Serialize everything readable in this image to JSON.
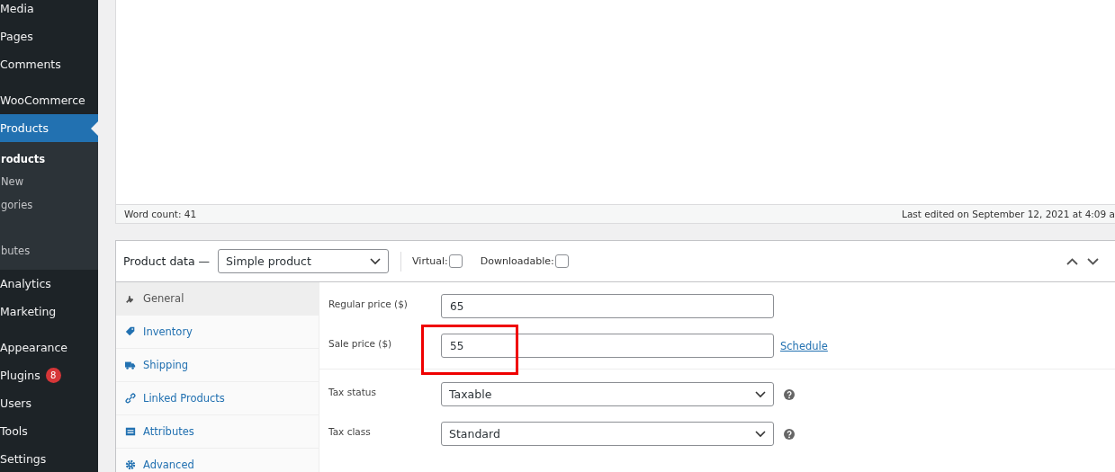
{
  "sidebar": {
    "groups": [
      [
        {
          "label": "Media",
          "selected": false
        },
        {
          "label": "Pages",
          "selected": false
        },
        {
          "label": "Comments",
          "selected": false
        }
      ],
      [
        {
          "label": "WooCommerce",
          "selected": false
        },
        {
          "label": "Products",
          "selected": true,
          "submenu": [
            {
              "kind": "item",
              "label": "roducts",
              "current": true
            },
            {
              "kind": "item",
              "label": "New",
              "current": false
            },
            {
              "kind": "item",
              "label": "gories",
              "current": false
            },
            {
              "kind": "blank"
            },
            {
              "kind": "item",
              "label": "butes",
              "current": false
            }
          ]
        },
        {
          "label": "Analytics",
          "selected": false
        },
        {
          "label": "Marketing",
          "selected": false
        }
      ],
      [
        {
          "label": "Appearance",
          "selected": false
        },
        {
          "label": "Plugins",
          "selected": false,
          "badge": "8"
        },
        {
          "label": "Users",
          "selected": false
        },
        {
          "label": "Tools",
          "selected": false
        },
        {
          "label": "Settings",
          "selected": false
        }
      ]
    ]
  },
  "editor": {
    "word_count": "Word count: 41",
    "last_edited": "Last edited on September 12, 2021 at 4:09 a"
  },
  "product_data": {
    "title": "Product data —",
    "type_select": "Simple product",
    "virtual": {
      "label": "Virtual:",
      "checked": false
    },
    "downloadable": {
      "label": "Downloadable:",
      "checked": false
    },
    "tabs": [
      {
        "label": "General",
        "selected": true
      },
      {
        "label": "Inventory",
        "selected": false
      },
      {
        "label": "Shipping",
        "selected": false
      },
      {
        "label": "Linked Products",
        "selected": false
      },
      {
        "label": "Attributes",
        "selected": false
      },
      {
        "label": "Advanced",
        "selected": false
      }
    ],
    "groups": [
      [
        {
          "kind": "input",
          "label": "Regular price ($)",
          "value": "65"
        },
        {
          "kind": "input",
          "label": "Sale price ($)",
          "value": "55",
          "link": "Schedule",
          "highlighted": true
        }
      ],
      [
        {
          "kind": "select",
          "label": "Tax status",
          "value": "Taxable"
        },
        {
          "kind": "select",
          "label": "Tax class",
          "value": "Standard"
        }
      ]
    ]
  }
}
